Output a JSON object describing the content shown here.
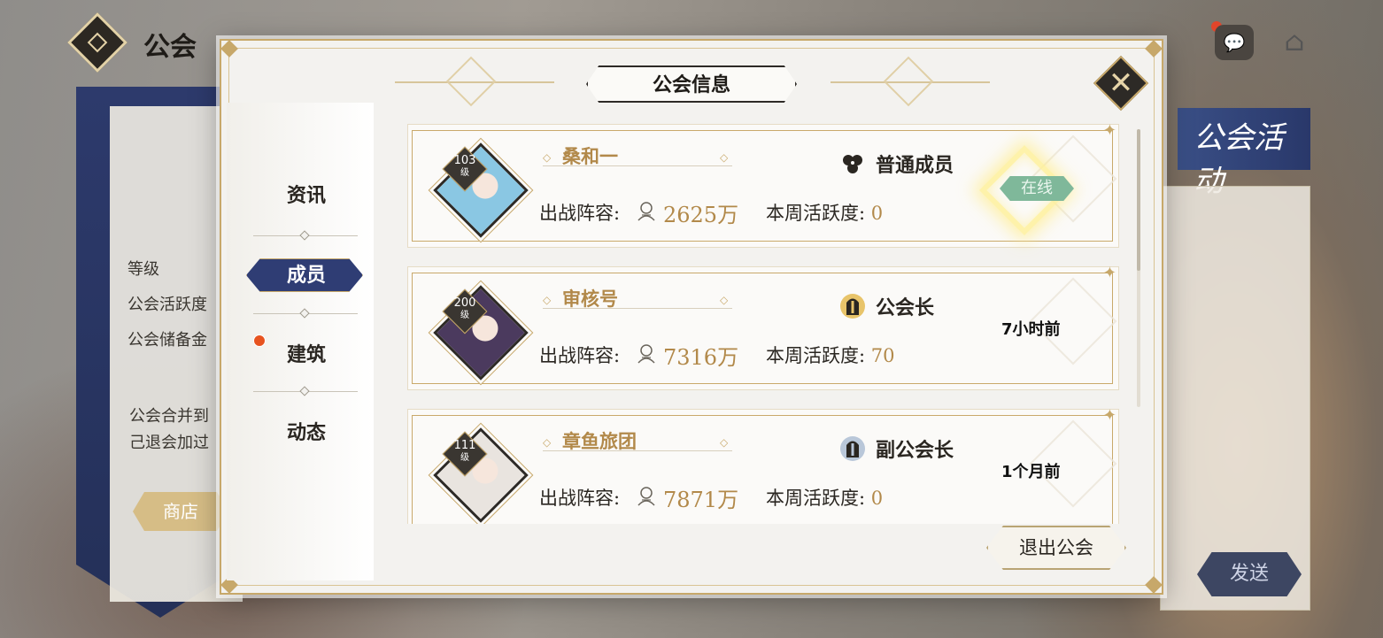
{
  "background": {
    "screen_title": "公会",
    "sidebar_texts": [
      "等级",
      "公会活跃度",
      "公会储备金"
    ],
    "notice_text": "公会合并到\n己退会加过",
    "shop_label": "商店",
    "activity_label": "公会活动",
    "send_label": "发送"
  },
  "modal": {
    "title": "公会信息",
    "close_icon": "close-x-icon",
    "nav": [
      {
        "label": "资讯",
        "active": false,
        "has_badge": false
      },
      {
        "label": "成员",
        "active": true,
        "has_badge": false
      },
      {
        "label": "建筑",
        "active": false,
        "has_badge": true
      },
      {
        "label": "动态",
        "active": false,
        "has_badge": false
      }
    ],
    "quit_label": "退出公会",
    "level_unit": "级",
    "power_label": "出战阵容:",
    "activity_label": "本周活跃度:",
    "members": [
      {
        "level": "103",
        "name": "桑和一",
        "power": "2625万",
        "activity": "0",
        "role": "普通成员",
        "role_icon": "clover-icon",
        "status": "在线",
        "online": true,
        "avatar_color": "#8ac7e3"
      },
      {
        "level": "200",
        "name": "审核号",
        "power": "7316万",
        "activity": "70",
        "role": "公会长",
        "role_icon": "helmet-gold-icon",
        "status": "7小时前",
        "online": false,
        "avatar_color": "#4b3a5e"
      },
      {
        "level": "111",
        "name": "章鱼旅团",
        "power": "7871万",
        "activity": "0",
        "role": "副公会长",
        "role_icon": "helmet-silver-icon",
        "status": "1个月前",
        "online": false,
        "avatar_color": "#e9e4df"
      }
    ]
  }
}
